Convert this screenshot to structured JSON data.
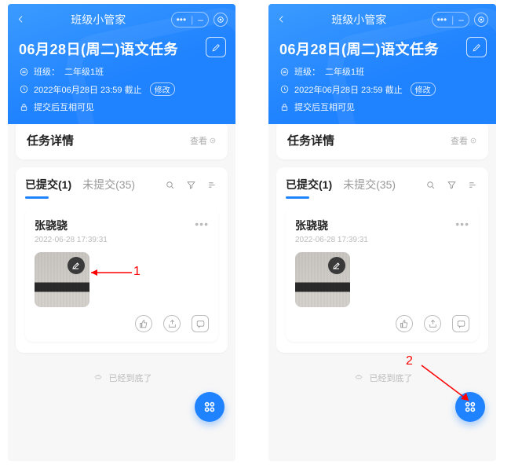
{
  "nav": {
    "title": "班级小管家"
  },
  "task": {
    "title": "06月28日(周二)语文任务",
    "class_label": "班级：",
    "class_value": "二年级1班",
    "deadline": "2022年06月28日 23:59 截止",
    "modify_tag": "修改",
    "visibility": "提交后互相可见"
  },
  "detail": {
    "title": "任务详情",
    "view": "查看"
  },
  "tabs": {
    "submitted": "已提交(1)",
    "unsubmitted": "未提交(35)"
  },
  "submission": {
    "name": "张骁骁",
    "time": "2022-06-28 17:39:31"
  },
  "footer": {
    "end": "已经到底了"
  },
  "annotations": {
    "one": "1",
    "two": "2"
  }
}
